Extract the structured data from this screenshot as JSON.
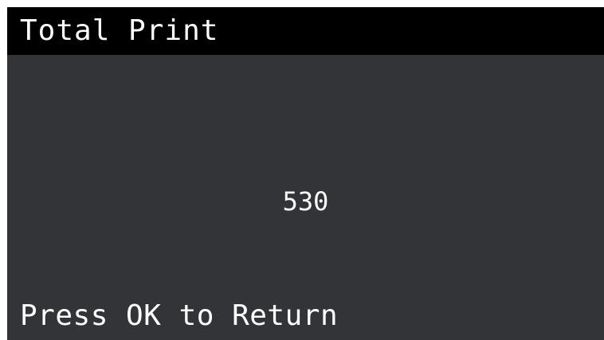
{
  "screen": {
    "title": "Total Print",
    "value": "530",
    "footer": "Press OK to Return"
  },
  "colors": {
    "title_bar_bg": "#000000",
    "screen_bg": "#323438",
    "text": "#ffffff"
  }
}
